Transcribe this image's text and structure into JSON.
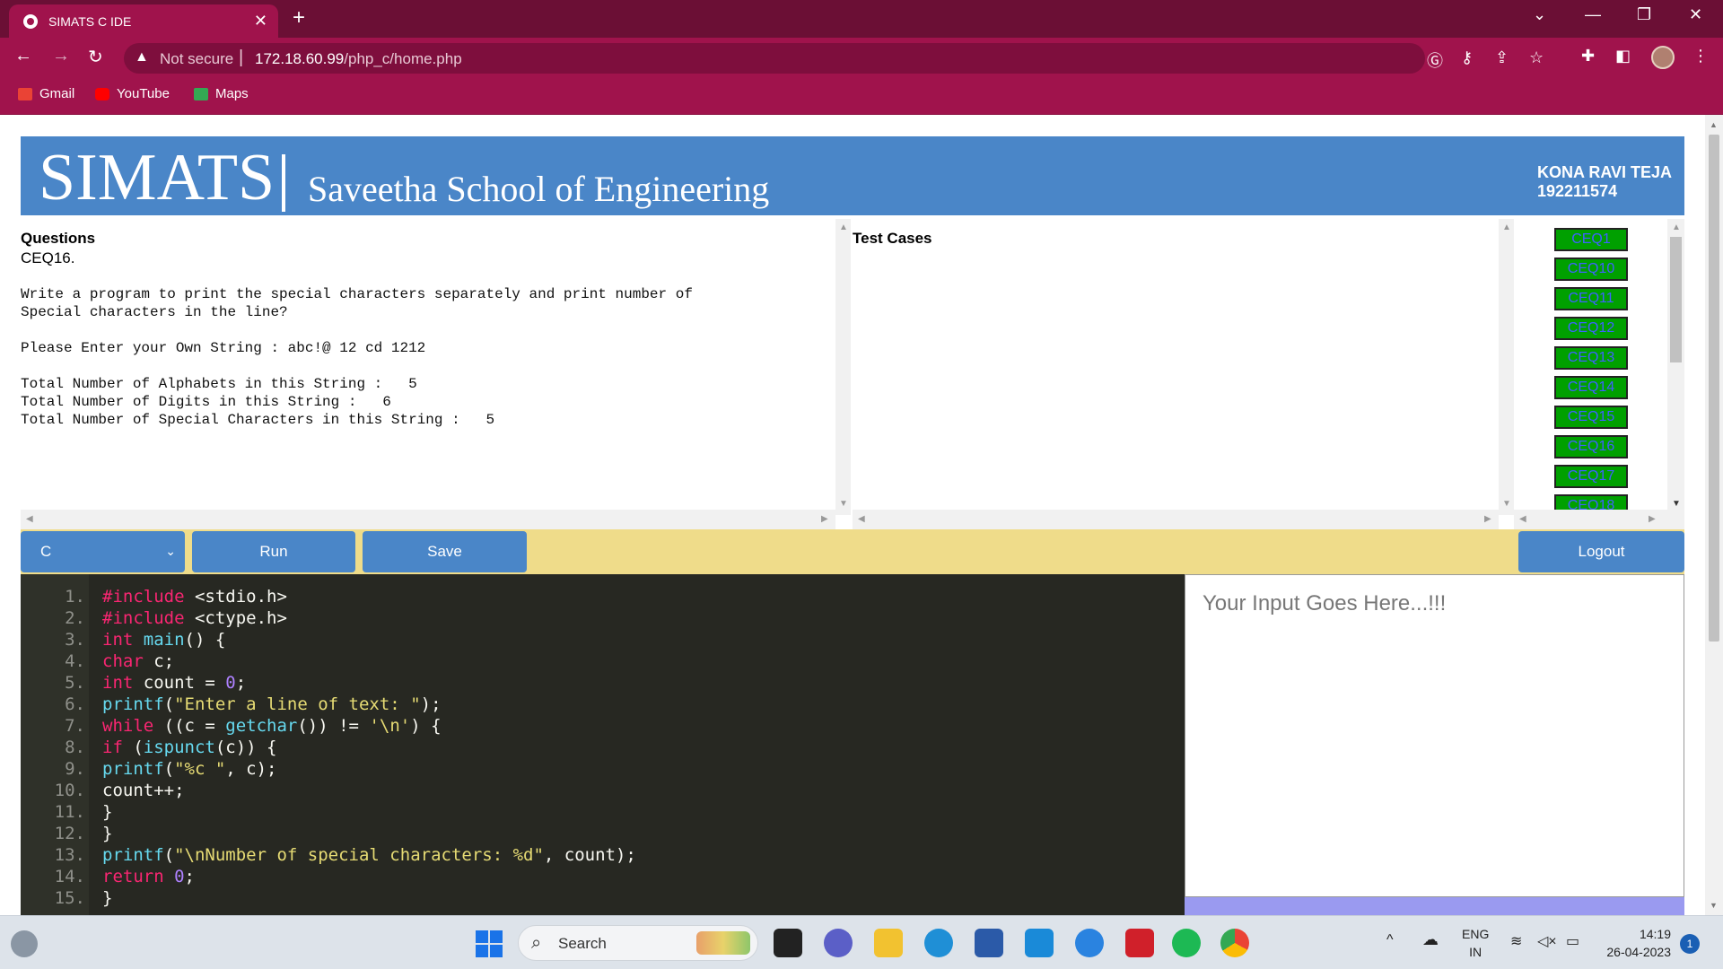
{
  "browser": {
    "tab_title": "SIMATS C IDE",
    "security_label": "Not secure",
    "url_host": "172.18.60.99",
    "url_path": "/php_c/home.php",
    "bookmarks": [
      {
        "label": "Gmail",
        "icon": "gmail-icon",
        "color": "#ea4335"
      },
      {
        "label": "YouTube",
        "icon": "youtube-icon",
        "color": "#ff0000"
      },
      {
        "label": "Maps",
        "icon": "maps-icon",
        "color": "#34a853"
      }
    ]
  },
  "banner": {
    "logo": "SIMATS",
    "school": "Saveetha School of Engineering",
    "user_name": "KONA RAVI TEJA",
    "user_id": "192211574"
  },
  "questions": {
    "heading": "Questions",
    "id": "CEQ16.",
    "text": "Write a program to print the special characters separately and print number of\nSpecial characters in the line?\n\nPlease Enter your Own String : abc!@ 12 cd 1212\n\nTotal Number of Alphabets in this String :   5\nTotal Number of Digits in this String :   6\nTotal Number of Special Characters in this String :   5"
  },
  "test_cases": {
    "heading": "Test Cases"
  },
  "question_list": [
    "CEQ1",
    "CEQ10",
    "CEQ11",
    "CEQ12",
    "CEQ13",
    "CEQ14",
    "CEQ15",
    "CEQ16",
    "CEQ17",
    "CEQ18"
  ],
  "controls": {
    "language": "C",
    "run_label": "Run",
    "save_label": "Save",
    "logout_label": "Logout"
  },
  "editor": {
    "line_numbers": [
      "1.",
      "2.",
      "3.",
      "4.",
      "5.",
      "6.",
      "7.",
      "8.",
      "9.",
      "10.",
      "11.",
      "12.",
      "13.",
      "14.",
      "15."
    ],
    "lines": [
      "#include <stdio.h>",
      "#include <ctype.h>",
      "int main() {",
      "char c;",
      "int count = 0;",
      "printf(\"Enter a line of text: \");",
      "while ((c = getchar()) != '\\n') {",
      "if (ispunct(c)) {",
      "printf(\"%c \", c);",
      "count++;",
      "}",
      "}",
      "printf(\"\\nNumber of special characters: %d\", count);",
      "return 0;",
      "}"
    ]
  },
  "input": {
    "placeholder": "Your Input Goes Here...!!!"
  },
  "taskbar": {
    "search_label": "Search",
    "lang_top": "ENG",
    "lang_bottom": "IN",
    "time": "14:19",
    "date": "26-04-2023",
    "notification_count": "1"
  },
  "colors": {
    "chrome_dark": "#6b0f35",
    "chrome": "#a0134c",
    "banner": "#4a86c8",
    "question_button": "#00a000",
    "control_bar": "#efdc8a",
    "editor_bg": "#272822"
  }
}
